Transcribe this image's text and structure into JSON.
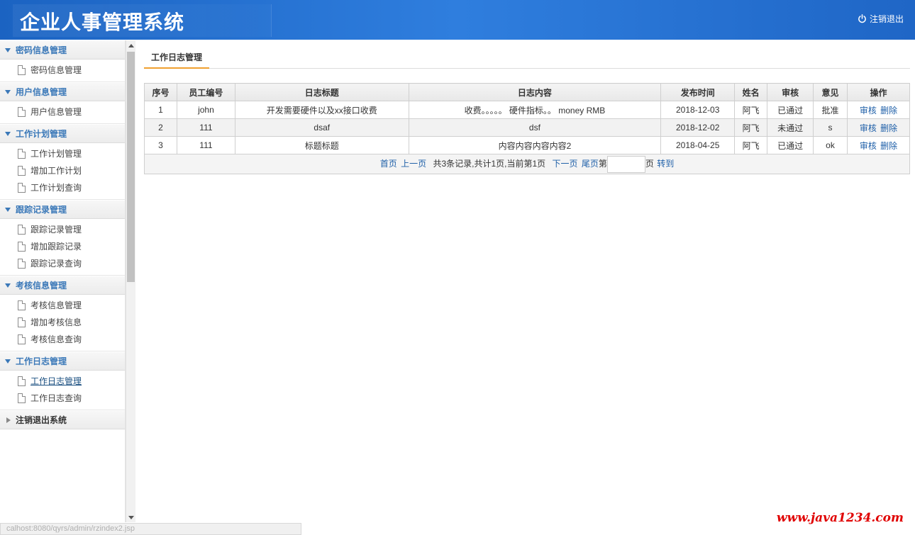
{
  "header": {
    "app_title": "企业人事管理系统",
    "logout_label": "注销退出"
  },
  "sidebar": {
    "groups": [
      {
        "label": "密码信息管理",
        "items": [
          "密码信息管理"
        ]
      },
      {
        "label": "用户信息管理",
        "items": [
          "用户信息管理"
        ]
      },
      {
        "label": "工作计划管理",
        "items": [
          "工作计划管理",
          "增加工作计划",
          "工作计划查询"
        ]
      },
      {
        "label": "跟踪记录管理",
        "items": [
          "跟踪记录管理",
          "增加跟踪记录",
          "跟踪记录查询"
        ]
      },
      {
        "label": "考核信息管理",
        "items": [
          "考核信息管理",
          "增加考核信息",
          "考核信息查询"
        ]
      },
      {
        "label": "工作日志管理",
        "items": [
          "工作日志管理",
          "工作日志查询"
        ]
      }
    ],
    "exit_label": "注销退出系统",
    "active_item": "工作日志管理"
  },
  "main": {
    "tab_label": "工作日志管理",
    "table": {
      "columns": [
        "序号",
        "员工编号",
        "日志标题",
        "日志内容",
        "发布时间",
        "姓名",
        "审核",
        "意见",
        "操作"
      ],
      "rows": [
        [
          "1",
          "john",
          "开发需要硬件以及xx接口收费",
          "收费。。。。。 硬件指标。。 money RMB",
          "2018-12-03",
          "阿飞",
          "已通过",
          "批准"
        ],
        [
          "2",
          "111",
          "dsaf",
          "dsf",
          "2018-12-02",
          "阿飞",
          "未通过",
          "s"
        ],
        [
          "3",
          "111",
          "标题标题",
          "内容内容内容内容2",
          "2018-04-25",
          "阿飞",
          "已通过",
          "ok"
        ]
      ],
      "action_review": "审核",
      "action_delete": "删除"
    },
    "pager": {
      "first": "首页",
      "prev": "上一页",
      "summary": "共3条记录,共计1页,当前第1页",
      "next": "下一页",
      "last": "尾页",
      "page_prefix": "第",
      "page_suffix": "页",
      "go": "转到"
    }
  },
  "watermark": "www.java1234.com",
  "statusbar": "calhost:8080/qyrs/admin/rzindex2.jsp"
}
